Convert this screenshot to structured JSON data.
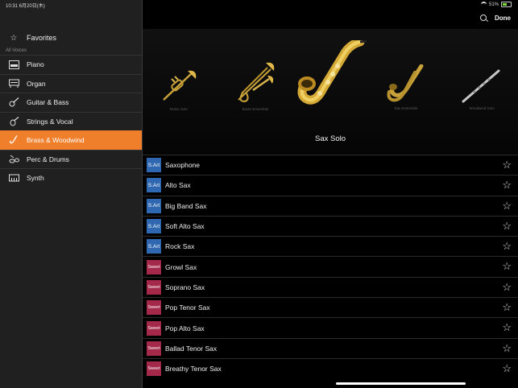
{
  "status": {
    "time_date": "10:31  6月20日(木)",
    "battery": "51%"
  },
  "sidebar": {
    "favorites": {
      "label": "Favorites",
      "icon": "star-icon"
    },
    "section_label": "All Voices",
    "items": [
      {
        "label": "Piano",
        "icon": "piano-icon",
        "active": false
      },
      {
        "label": "Organ",
        "icon": "organ-icon",
        "active": false
      },
      {
        "label": "Guitar & Bass",
        "icon": "guitar-icon",
        "active": false
      },
      {
        "label": "Strings & Vocal",
        "icon": "violin-icon",
        "active": false
      },
      {
        "label": "Brass & Woodwind",
        "icon": "saxophone-icon",
        "active": true
      },
      {
        "label": "Perc & Drums",
        "icon": "drums-icon",
        "active": false
      },
      {
        "label": "Synth",
        "icon": "keyboard-icon",
        "active": false
      }
    ]
  },
  "header": {
    "done_label": "Done"
  },
  "carousel": {
    "categories": [
      {
        "label": "Brass Solo",
        "icon": "trumpet-image"
      },
      {
        "label": "Brass Ensemble",
        "icon": "trombone-trumpet-image"
      },
      {
        "label": "",
        "icon": "alto-saxophone-image"
      },
      {
        "label": "Sax Ensemble",
        "icon": "saxophones-image"
      },
      {
        "label": "Woodwind Solo",
        "icon": "flute-image"
      }
    ],
    "current_title": "Sax Solo"
  },
  "voices": [
    {
      "badge": "S.Art",
      "name": "Saxophone"
    },
    {
      "badge": "S.Art",
      "name": "Alto Sax"
    },
    {
      "badge": "S.Art",
      "name": "Big Band Sax"
    },
    {
      "badge": "S.Art",
      "name": "Soft Alto Sax"
    },
    {
      "badge": "S.Art",
      "name": "Rock Sax"
    },
    {
      "badge": "Sweet",
      "name": "Growl Sax"
    },
    {
      "badge": "Sweet",
      "name": "Soprano Sax"
    },
    {
      "badge": "Sweet",
      "name": "Pop Tenor Sax"
    },
    {
      "badge": "Sweet",
      "name": "Pop Alto Sax"
    },
    {
      "badge": "Sweet",
      "name": "Ballad Tenor Sax"
    },
    {
      "badge": "Sweet",
      "name": "Breathy Tenor Sax"
    }
  ],
  "colors": {
    "accent": "#f07f2c",
    "sart": "#2f68b0",
    "sweet": "#a3284a"
  }
}
